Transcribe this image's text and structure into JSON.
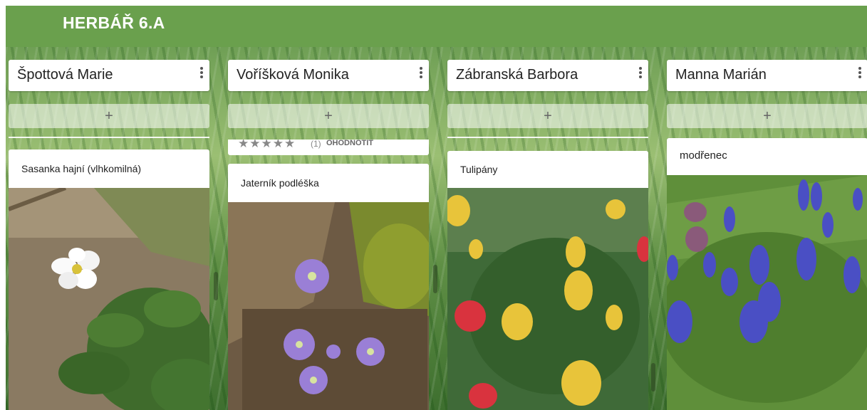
{
  "app": {
    "title": "HERBÁŘ 6.A"
  },
  "columns": [
    {
      "name": "Špottová Marie",
      "add_label": "+",
      "card_title": "Sasanka hajní (vlhkomilná)"
    },
    {
      "name": "Voříšková Monika",
      "add_label": "+",
      "rating_stars": "★★★★★",
      "rating_count": "(1)",
      "rate_label": "OHODNOTIT",
      "card_title": "Jaterník podléška"
    },
    {
      "name": "Zábranská Barbora",
      "add_label": "+",
      "card_title": "Tulipány"
    },
    {
      "name": "Manna Marián",
      "add_label": "+",
      "card_title": "modřenec"
    }
  ],
  "colors": {
    "brand": "#6aa04d"
  }
}
